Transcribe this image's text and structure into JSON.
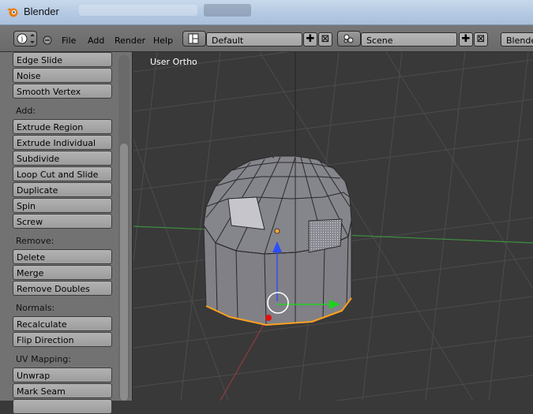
{
  "window": {
    "title": "Blender"
  },
  "header": {
    "menus": [
      "File",
      "Add",
      "Render",
      "Help"
    ],
    "screen_layout": "Default",
    "scene": "Scene",
    "render_engine": "Blende"
  },
  "toolshelf": {
    "top_buttons": [
      "Edge Slide",
      "Noise",
      "Smooth Vertex"
    ],
    "sections": [
      {
        "label": "Add:",
        "buttons": [
          "Extrude Region",
          "Extrude Individual",
          "Subdivide",
          "Loop Cut and Slide",
          "Duplicate",
          "Spin",
          "Screw"
        ]
      },
      {
        "label": "Remove:",
        "buttons": [
          "Delete",
          "Merge",
          "Remove Doubles"
        ]
      },
      {
        "label": "Normals:",
        "buttons": [
          "Recalculate",
          "Flip Direction"
        ]
      },
      {
        "label": "UV Mapping:",
        "buttons": [
          "Unwrap",
          "Mark Seam"
        ]
      }
    ]
  },
  "viewport": {
    "view_label": "User Ortho"
  },
  "icons": {
    "app": "blender-logo-icon",
    "info_editor": "info-editor-icon",
    "collapse": "collapse-menus-icon",
    "layout": "screen-layout-icon",
    "scene": "scene-icon",
    "add": "plus-icon",
    "remove": "x-icon"
  },
  "colors": {
    "viewport_bg": "#393939",
    "grid": "#4a4a4a",
    "x_axis": "#a83a3a",
    "y_axis": "#3a9a3a",
    "mesh_face": "#7f7f86",
    "selected_edge": "#ffa020",
    "gizmo_z": "#2b4eff",
    "gizmo_y": "#1fd11f"
  }
}
